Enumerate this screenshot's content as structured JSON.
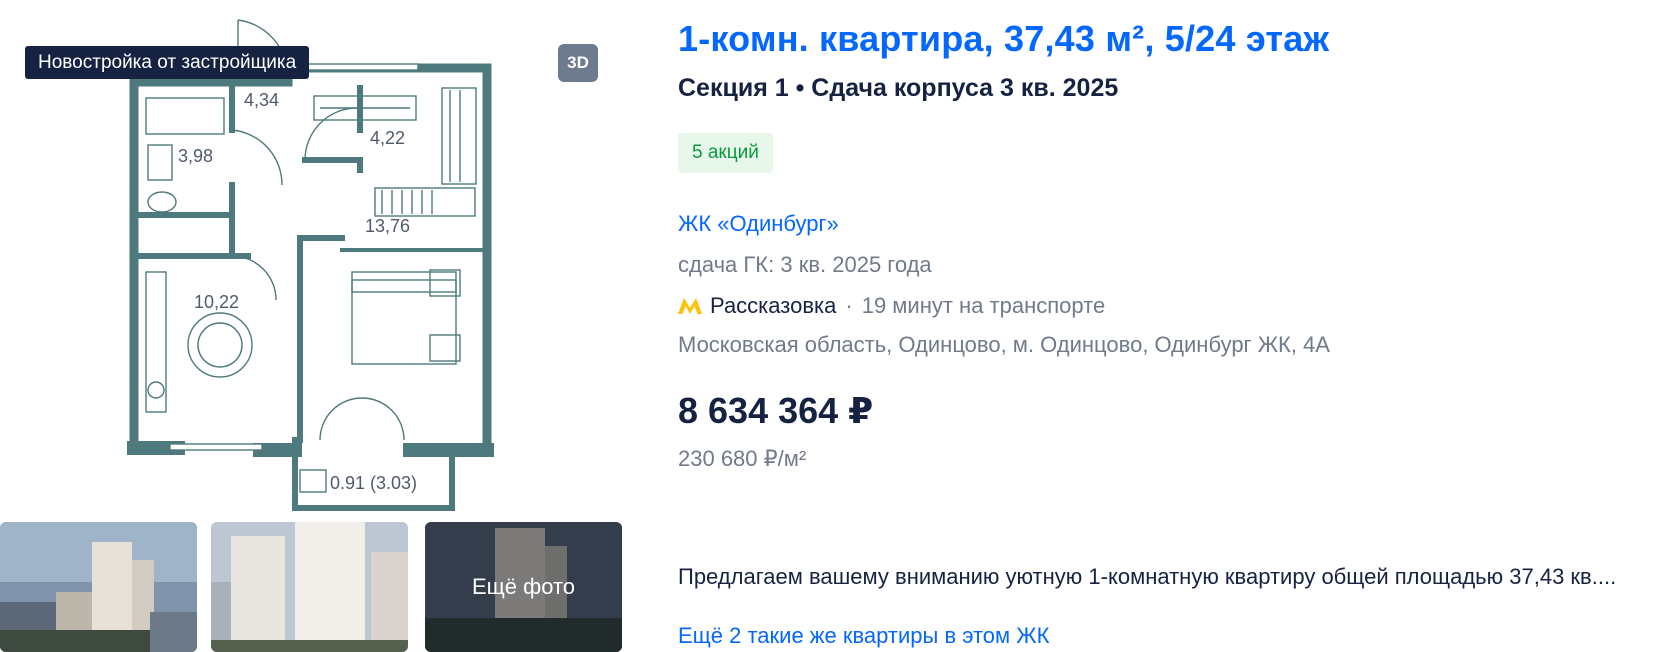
{
  "badges": {
    "new_building": "Новостройка от застройщика",
    "view_3d": "3D"
  },
  "floor_plan": {
    "rooms": [
      {
        "area": "4,34"
      },
      {
        "area": "3,98"
      },
      {
        "area": "4,22"
      },
      {
        "area": "13,76"
      },
      {
        "area": "10,22"
      },
      {
        "area": "0.91 (3.03)"
      }
    ],
    "wall_color": "#4e7a7d"
  },
  "thumbnails": {
    "more_photos_label": "Ещё фото"
  },
  "listing": {
    "title": "1-комн. квартира, 37,43 м², 5/24 этаж",
    "subtitle": "Секция 1 • Сдача корпуса 3 кв. 2025",
    "promotions": "5 акций",
    "complex_name": "ЖК «Одинбург»",
    "completion": "сдача ГК: 3 кв. 2025 года",
    "metro": {
      "station": "Рассказовка",
      "separator": "·",
      "time": "19 минут на транспорте",
      "icon": "metro-icon",
      "icon_color": "#ffc107"
    },
    "address": "Московская область, Одинцово, м. Одинцово, Одинбург ЖК, 4А",
    "price": "8 634 364 ₽",
    "price_per_m2": "230 680 ₽/м²",
    "description": "Предлагаем вашему вниманию уютную 1-комнатную квартиру общей площадью 37,43 кв....",
    "similar_link": "Ещё 2 такие же квартиры в этом ЖК"
  },
  "colors": {
    "link_blue": "#0468ff",
    "text_dark": "#152242",
    "text_gray": "#707a8a",
    "promo_bg": "#e8f7ec",
    "promo_text": "#0b9a3b"
  }
}
